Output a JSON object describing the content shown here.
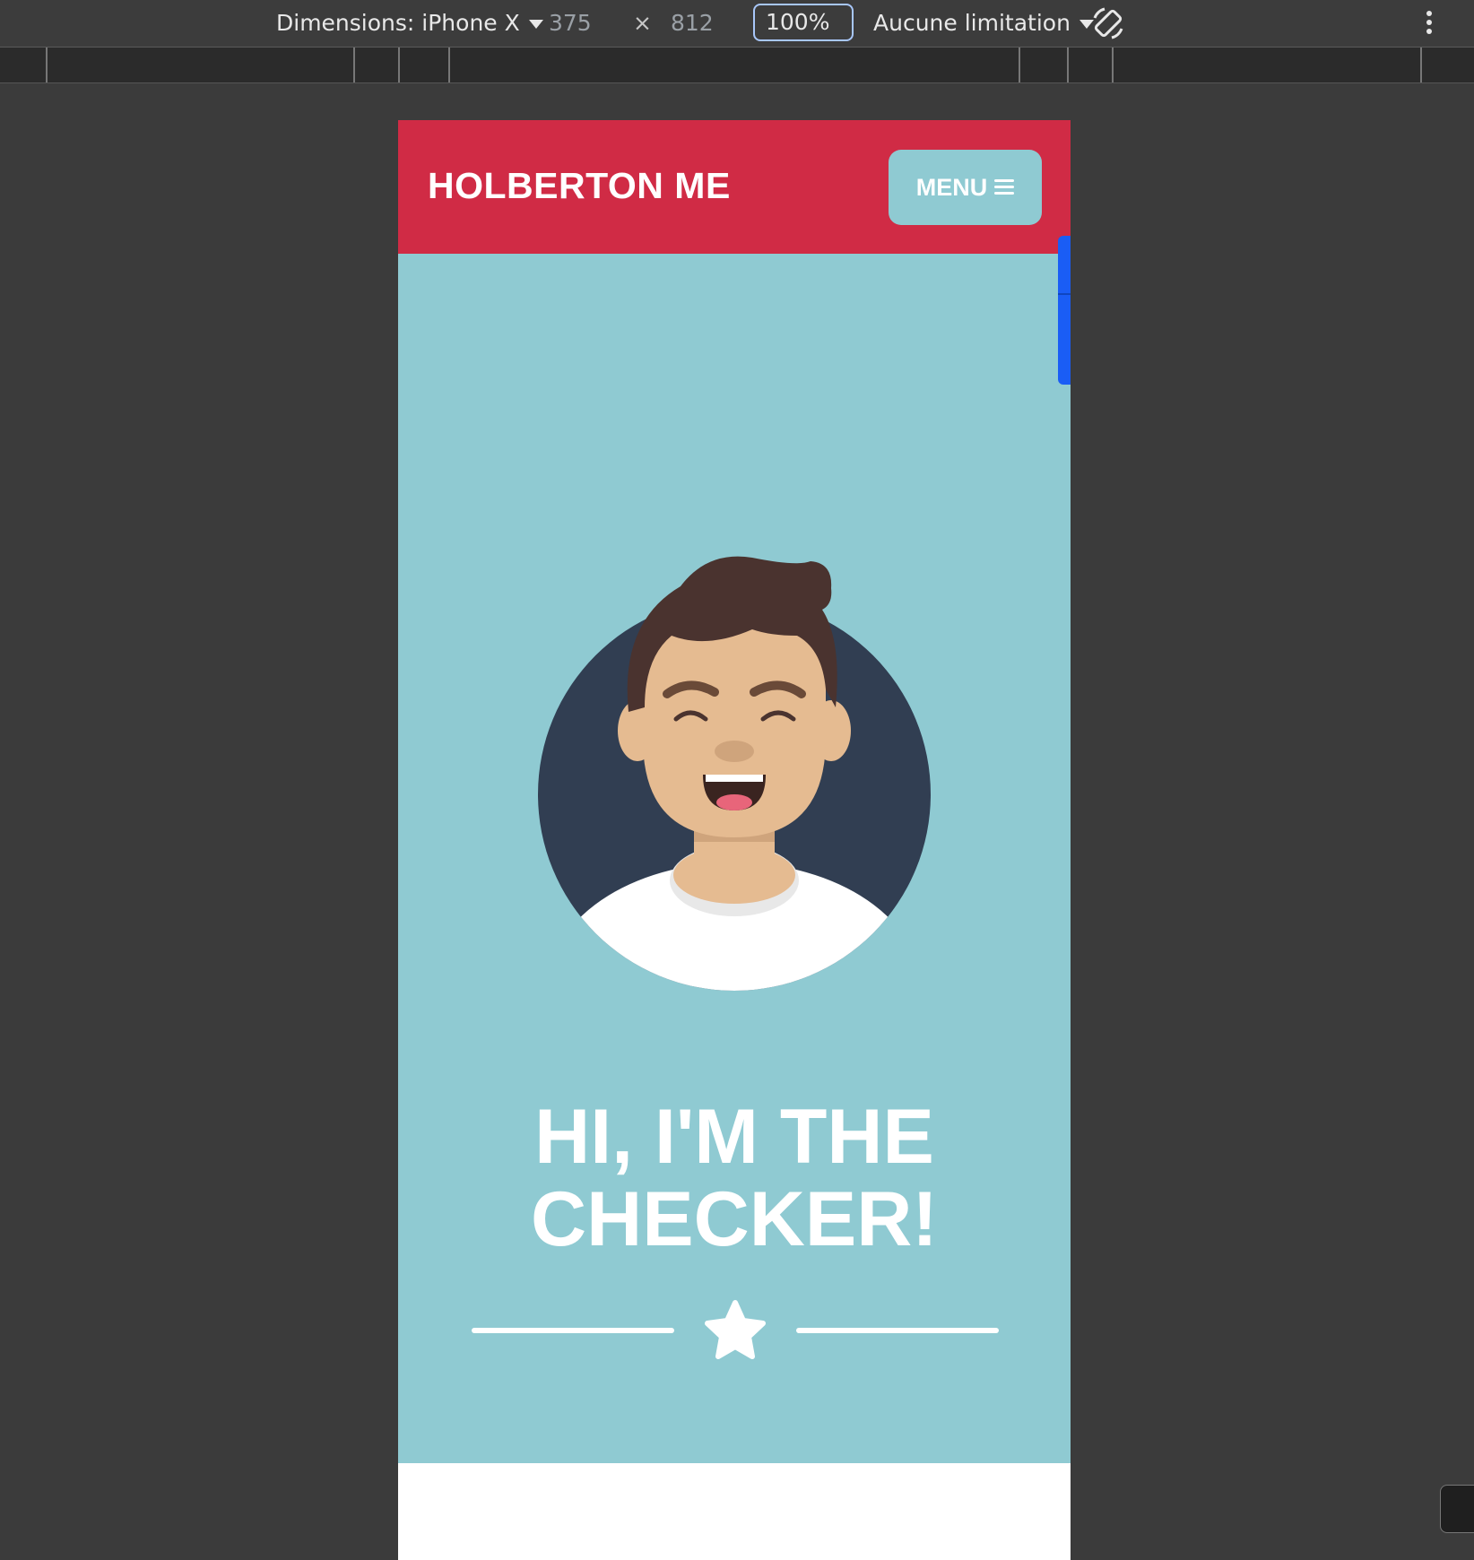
{
  "devtools": {
    "dimensions_label": "Dimensions: iPhone X",
    "width_value": "375",
    "times_symbol": "×",
    "height_value": "812",
    "zoom_value": "100%",
    "throttle_label": "Aucune limitation",
    "rotate_icon": "rotate-icon",
    "more_icon": "kebab-menu-icon"
  },
  "page": {
    "brand": "HOLBERTON ME",
    "menu_label": "MENU",
    "menu_icon": "hamburger-icon",
    "headline_line1": "HI, I'M THE",
    "headline_line2": "CHECKER!",
    "divider_icon": "star-icon"
  },
  "colors": {
    "header_red": "#d02b45",
    "hero_teal": "#8fcad2",
    "avatar_circle": "#313e52",
    "hair": "#4a332f",
    "skin": "#e5bb91",
    "scroll_blue": "#1a5df5"
  }
}
